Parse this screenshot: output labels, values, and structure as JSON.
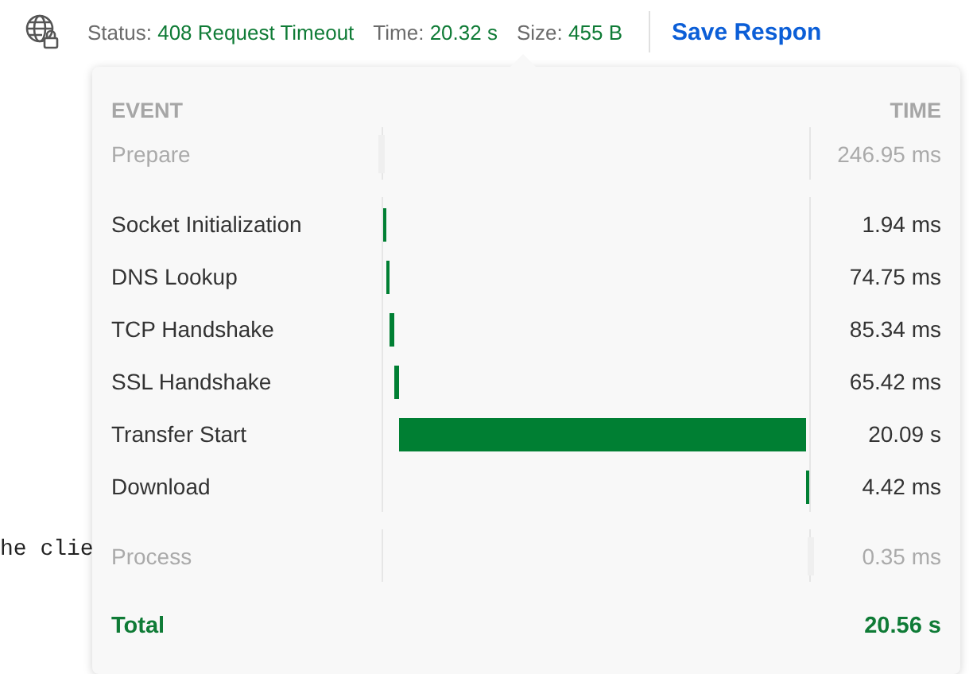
{
  "status_bar": {
    "items": [
      {
        "label": "Status:",
        "value": "408 Request Timeout"
      },
      {
        "label": "Time:",
        "value": "20.32 s"
      },
      {
        "label": "Size:",
        "value": "455 B"
      }
    ],
    "save_button": "Save Respon"
  },
  "body_text": "he clie",
  "timing": {
    "columns": [
      "EVENT",
      "TIME"
    ],
    "events": [
      {
        "kind": "phase",
        "name": "Prepare",
        "time": "246.95 ms"
      },
      {
        "kind": "step",
        "name": "Socket Initialization",
        "time": "1.94 ms",
        "level": 0.008
      },
      {
        "kind": "step",
        "name": "DNS Lookup",
        "time": "74.75 ms",
        "level": 0.008
      },
      {
        "kind": "step",
        "name": "TCP Handshake",
        "time": "85.34 ms",
        "level": 0.01
      },
      {
        "kind": "step",
        "name": "SSL Handshake",
        "time": "65.42 ms",
        "level": 0.01
      },
      {
        "kind": "step",
        "name": "Transfer Start",
        "time": "20.09 s",
        "level": 0.957
      },
      {
        "kind": "step",
        "name": "Download",
        "time": "4.42 ms",
        "level": 0.008
      },
      {
        "kind": "phase",
        "name": "Process",
        "time": "0.35 ms"
      }
    ],
    "total": {
      "label": "Total",
      "time": "20.56 s"
    }
  }
}
